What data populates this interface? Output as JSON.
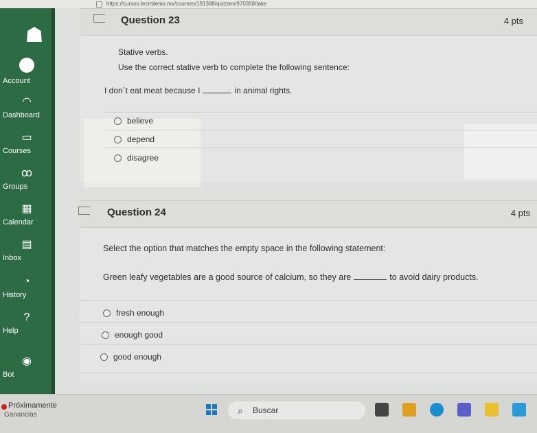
{
  "browser": {
    "url": "https://cursos.tecmilenio.mx/courses/191388/quizzes/970358/take"
  },
  "sidebar": {
    "items": [
      {
        "label": "Account",
        "icon": "account-avatar-icon"
      },
      {
        "label": "Dashboard",
        "icon": "dashboard-gauge-icon"
      },
      {
        "label": "Courses",
        "icon": "courses-book-icon"
      },
      {
        "label": "Groups",
        "icon": "groups-people-icon"
      },
      {
        "label": "Calendar",
        "icon": "calendar-icon"
      },
      {
        "label": "Inbox",
        "icon": "inbox-icon"
      },
      {
        "label": "History",
        "icon": "history-clock-icon"
      },
      {
        "label": "Help",
        "icon": "help-icon"
      },
      {
        "label": "Bot",
        "icon": "bot-icon"
      }
    ],
    "colors": {
      "background": "#2d6b45",
      "text": "#ffffff"
    }
  },
  "questions": [
    {
      "title": "Question 23",
      "points": "4 pts",
      "instruction_1": "Stative verbs.",
      "instruction_2": "Use the correct stative verb to complete the following sentence:",
      "sentence_before": "I don´t eat meat because I",
      "sentence_after": "in animal rights.",
      "options": [
        "believe",
        "depend",
        "disagree"
      ]
    },
    {
      "title": "Question 24",
      "points": "4 pts",
      "instruction_1": "Select the option that matches the empty space in the following statement:",
      "sentence_before": "Green leafy vegetables are a good source of calcium, so they are",
      "sentence_after": "to avoid dairy products.",
      "options": [
        "fresh enough",
        "enough good",
        "good enough"
      ]
    }
  ],
  "taskbar": {
    "notification_title": "Próximamente",
    "notification_sub": "Ganancias",
    "search_label": "Buscar"
  }
}
